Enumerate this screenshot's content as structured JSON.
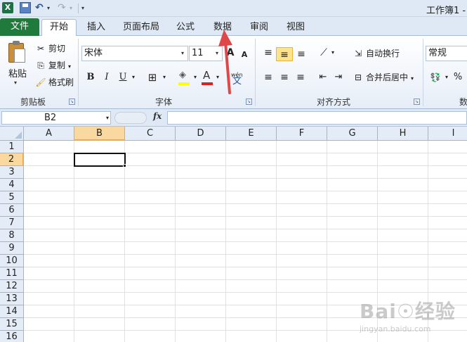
{
  "quick_access": {
    "app_icon": "excel-icon",
    "app_icon_letter": "X",
    "undo_glyph": "↶",
    "redo_glyph": "↷",
    "dropdown_glyph": "▾"
  },
  "window": {
    "title": "工作簿1 -"
  },
  "tabs": {
    "file": "文件",
    "items": [
      "开始",
      "插入",
      "页面布局",
      "公式",
      "数据",
      "审阅",
      "视图"
    ],
    "active_index": 0
  },
  "ribbon": {
    "clipboard": {
      "label": "剪贴板",
      "paste": "粘贴",
      "cut": "剪切",
      "copy": "复制",
      "format_painter": "格式刷"
    },
    "font": {
      "label": "字体",
      "font_name": "宋体",
      "font_size": "11",
      "grow": "A",
      "shrink": "A",
      "bold": "B",
      "italic": "I",
      "underline": "U",
      "font_color_letter": "A",
      "phonetic": "wén",
      "phonetic_char": "文"
    },
    "alignment": {
      "label": "对齐方式",
      "wrap_text": "自动换行",
      "merge_center": "合并后居中"
    },
    "number": {
      "label": "数",
      "format": "常规",
      "percent": "%"
    }
  },
  "formula_bar": {
    "name_box": "B2",
    "fx": "fx",
    "formula": ""
  },
  "sheet": {
    "columns": [
      "A",
      "B",
      "C",
      "D",
      "E",
      "F",
      "G",
      "H",
      "I"
    ],
    "rows": [
      "1",
      "2",
      "3",
      "4",
      "5",
      "6",
      "7",
      "8",
      "9",
      "10",
      "11",
      "12",
      "13",
      "14",
      "15",
      "16"
    ],
    "selected_column": "B",
    "selected_row": "2"
  },
  "colors": {
    "file_tab": "#1f7a3c",
    "selection_header": "#f9d99f",
    "annotation_arrow": "#e04848"
  },
  "watermark": {
    "brand": "Bai☉经验",
    "url": "jingyan.baidu.com"
  }
}
